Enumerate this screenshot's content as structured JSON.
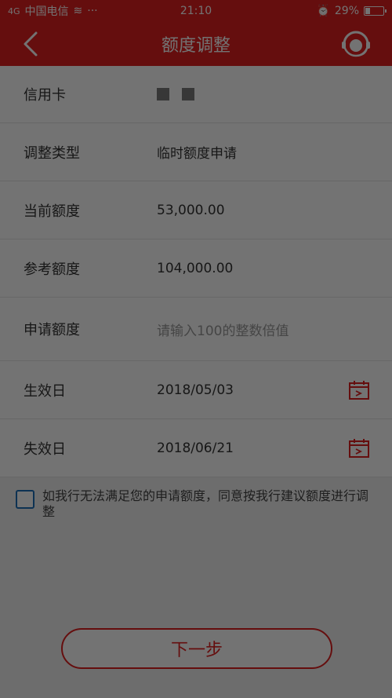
{
  "status_bar": {
    "carrier": "中国电信",
    "signal_text": "4G",
    "time": "21:10",
    "battery": "29%",
    "battery_level": 0.29
  },
  "nav": {
    "title": "额度调整"
  },
  "form": {
    "card": {
      "label": "信用卡"
    },
    "adjust_type": {
      "label": "调整类型",
      "value": "临时额度申请"
    },
    "current_limit": {
      "label": "当前额度",
      "value": "53,000.00"
    },
    "reference_limit": {
      "label": "参考额度",
      "value": "104,000.00"
    },
    "apply_limit": {
      "label": "申请额度",
      "placeholder": "请输入100的整数倍值"
    },
    "effective_date": {
      "label": "生效日",
      "value": "2018/05/03"
    },
    "expiry_date": {
      "label": "失效日",
      "value": "2018/06/21"
    }
  },
  "agreement": {
    "text": "如我行无法满足您的申请额度，同意按我行建议额度进行调整"
  },
  "next_button": {
    "label": "下一步"
  },
  "colors": {
    "brand_red": "#e02020",
    "checkbox_blue": "#1d6fb8"
  }
}
